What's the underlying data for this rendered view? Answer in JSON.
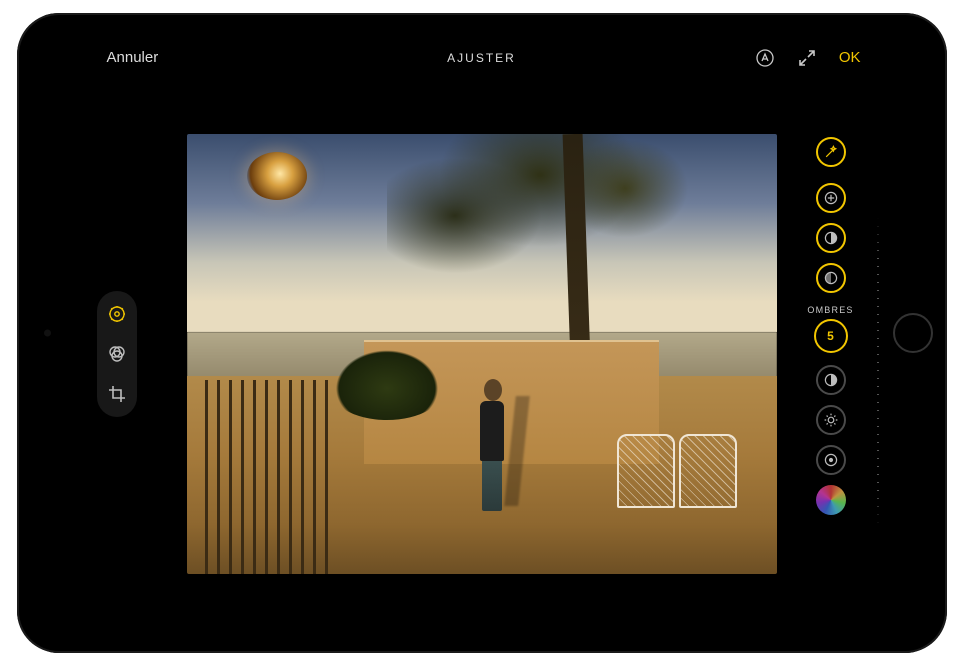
{
  "header": {
    "cancel_label": "Annuler",
    "title": "AJUSTER",
    "ok_label": "OK"
  },
  "left_tools": {
    "adjust": "adjust",
    "filters": "filters",
    "crop": "crop"
  },
  "adjustments": {
    "selected_label": "OMBRES",
    "selected_value": "5",
    "items": [
      {
        "id": "auto",
        "icon": "wand"
      },
      {
        "id": "exposure",
        "icon": "exposure"
      },
      {
        "id": "brilliance",
        "icon": "half"
      },
      {
        "id": "highlights",
        "icon": "half-alt"
      },
      {
        "id": "shadows",
        "icon": "value",
        "active": true
      },
      {
        "id": "contrast",
        "icon": "half"
      },
      {
        "id": "brightness",
        "icon": "sun"
      },
      {
        "id": "blackpoint",
        "icon": "dot"
      },
      {
        "id": "saturation",
        "icon": "spectrum"
      }
    ]
  },
  "colors": {
    "accent": "#f2c600"
  }
}
